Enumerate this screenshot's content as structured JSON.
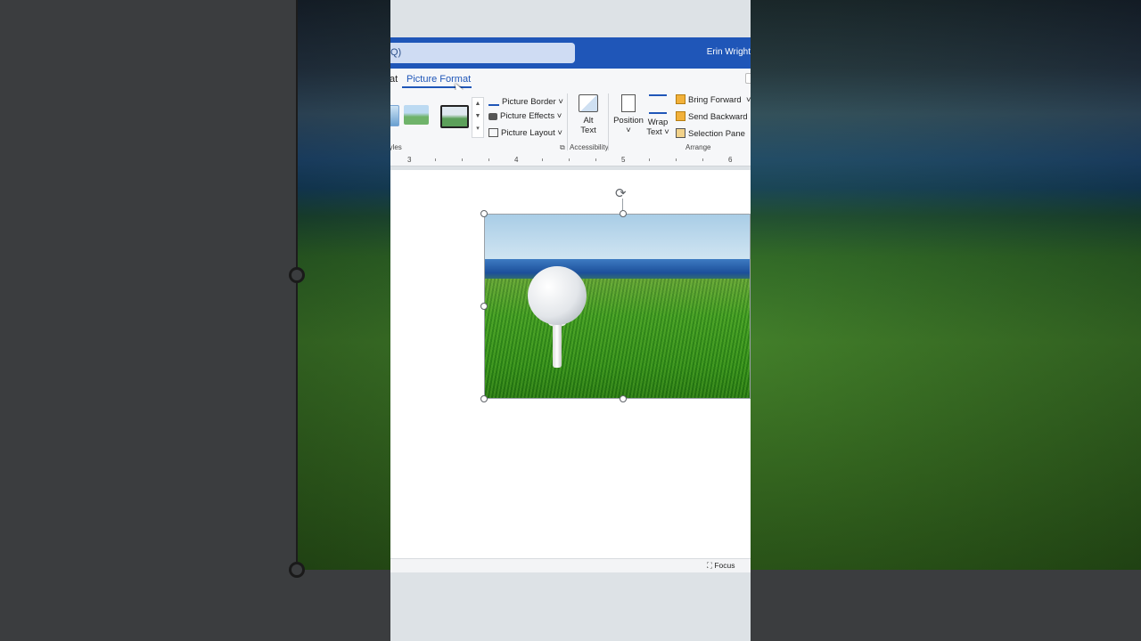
{
  "header": {
    "search_fragment": "Q)",
    "user_name": "Erin Wright"
  },
  "tabs": [
    {
      "label": "at"
    },
    {
      "label": "Picture Format"
    }
  ],
  "ribbon": {
    "styles_group_label": "Styles",
    "picture_border": "Picture Border",
    "picture_effects": "Picture Effects",
    "picture_layout": "Picture Layout",
    "alt_text_line1": "Alt",
    "alt_text_line2": "Text",
    "accessibility_label": "Accessibility",
    "position": "Position",
    "wrap_text_line1": "Wrap",
    "wrap_text_line2": "Text",
    "bring_forward": "Bring Forward",
    "send_backward": "Send Backward",
    "selection_pane": "Selection Pane",
    "arrange_label": "Arrange"
  },
  "ruler": {
    "numbers": [
      "3",
      "4",
      "5",
      "6"
    ]
  },
  "status": {
    "focus": "Focus"
  },
  "colors": {
    "accent": "#1f56b8",
    "ribbon_bg": "#f6f7f9"
  }
}
